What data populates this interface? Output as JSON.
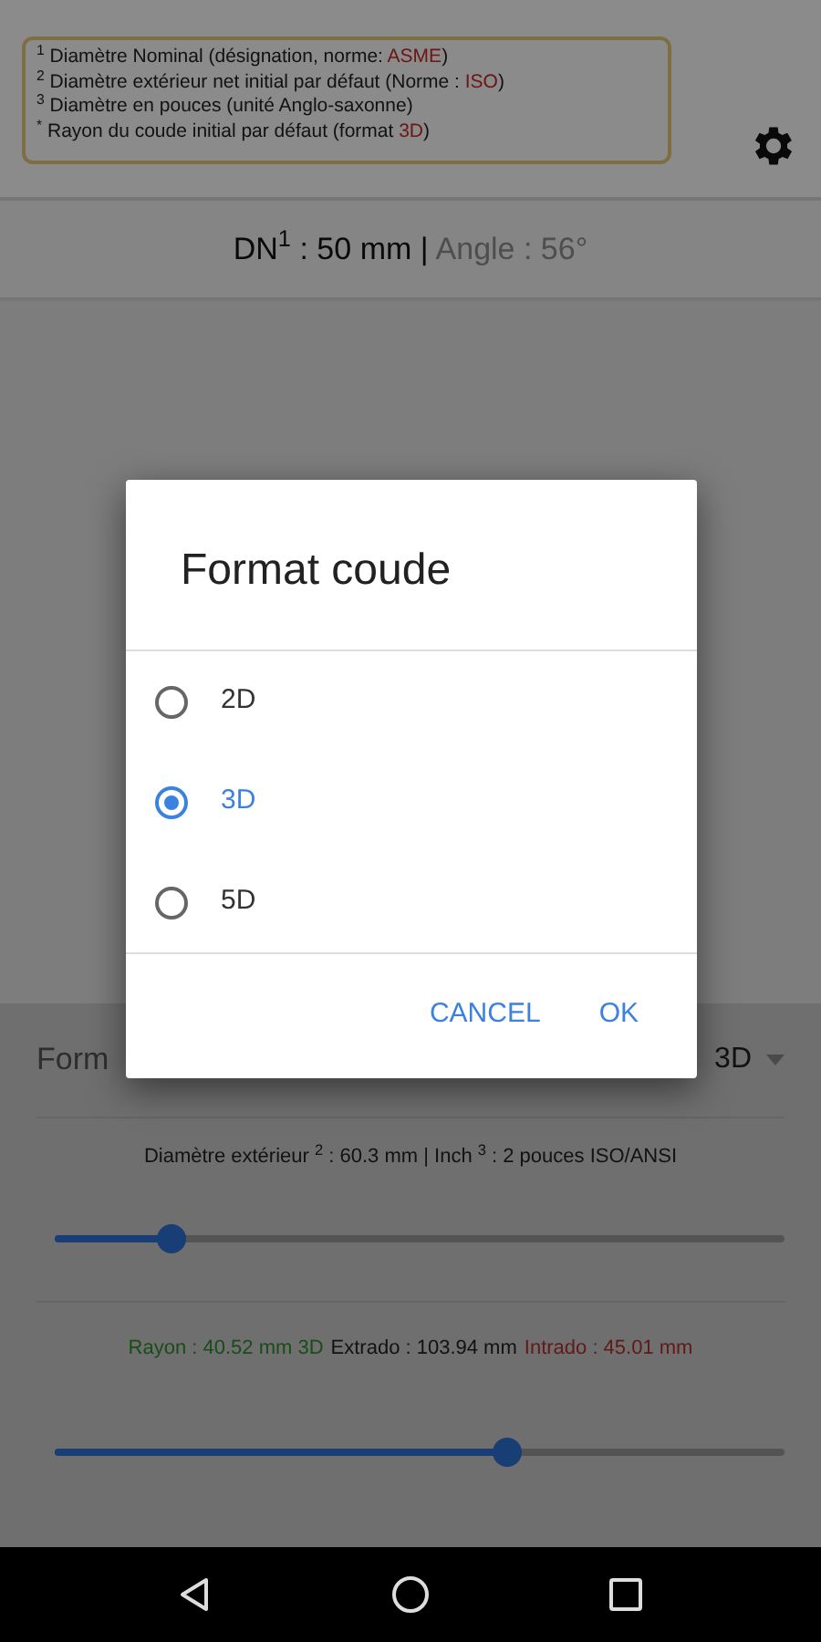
{
  "footnotes": [
    {
      "mark": "1",
      "text": "Diamètre Nominal (désignation, norme: ",
      "accent": "ASME",
      "after": ")"
    },
    {
      "mark": "2",
      "text": "Diamètre extérieur net initial par défaut (Norme : ",
      "accent": "ISO",
      "after": ")"
    },
    {
      "mark": "3",
      "text": "Diamètre en pouces (unité Anglo-saxonne)"
    },
    {
      "mark": "*",
      "text": "Rayon du coude initial par défaut (format ",
      "accent": "3D",
      "after": ")"
    }
  ],
  "summary": {
    "dn": "DN$^{1}$ : 50 mm |",
    "angle": "Angle : 56°"
  },
  "format_row": {
    "label": "Form",
    "value": "3D"
  },
  "diameter_text": "Diamètre extérieur $^{2}$ : 60.3 mm | Inch $^{3}$ : 2 pouces ISO/ANSI",
  "slider_1": {
    "level": 0.16
  },
  "result_parts": [
    {
      "kind": "good",
      "text": "Rayon : 40.52 mm 3D"
    },
    {
      "kind": "plain",
      "text": "Extrado : 103.94 mm"
    },
    {
      "kind": "bad",
      "text": "Intrado : 45.01 mm"
    }
  ],
  "slider_2": {
    "level": 0.62
  },
  "dialog": {
    "title": "Format coude",
    "options": [
      {
        "label": "2D",
        "selected": false
      },
      {
        "label": "3D",
        "selected": true
      },
      {
        "label": "5D",
        "selected": false
      }
    ],
    "buttons": [
      "CANCEL",
      "OK"
    ]
  }
}
